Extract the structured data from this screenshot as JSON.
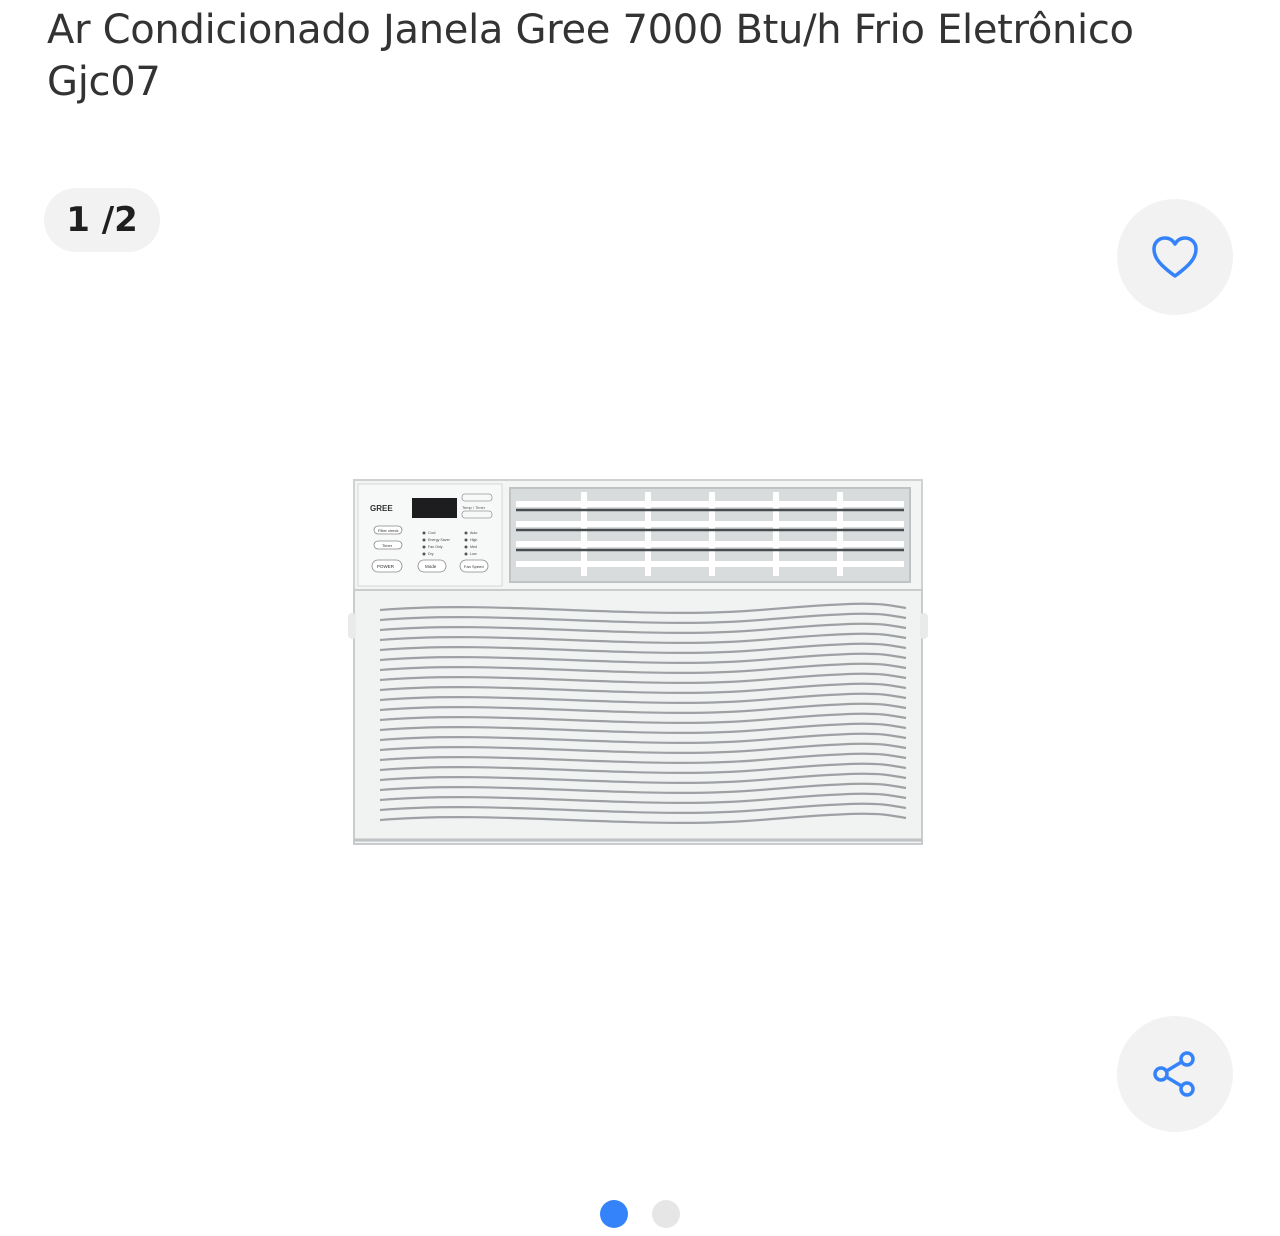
{
  "product": {
    "title": "Ar Condicionado Janela Gree 7000 Btu/h Frio Eletrônico Gjc07"
  },
  "gallery": {
    "counter": "1 /2",
    "current_index": 1,
    "total": 2,
    "dots": [
      {
        "active": true
      },
      {
        "active": false
      }
    ],
    "image_panel": {
      "brand": "GREE",
      "left_buttons": [
        "Filter check",
        "Timer",
        "POWER"
      ],
      "mode_leds": [
        "Cool",
        "Energy Saver",
        "Fan Only",
        "Dry"
      ],
      "fan_leds": [
        "Auto",
        "High",
        "Med",
        "Low"
      ],
      "bottom_buttons": [
        "Mode",
        "Fan Speed"
      ],
      "temp_label": "Temp / Timer"
    }
  },
  "actions": {
    "favorite_icon": "heart-icon",
    "share_icon": "share-icon"
  },
  "colors": {
    "accent": "#3483fa",
    "button_bg": "#f2f2f2",
    "dot_inactive": "#e6e6e6",
    "text": "#333333"
  }
}
